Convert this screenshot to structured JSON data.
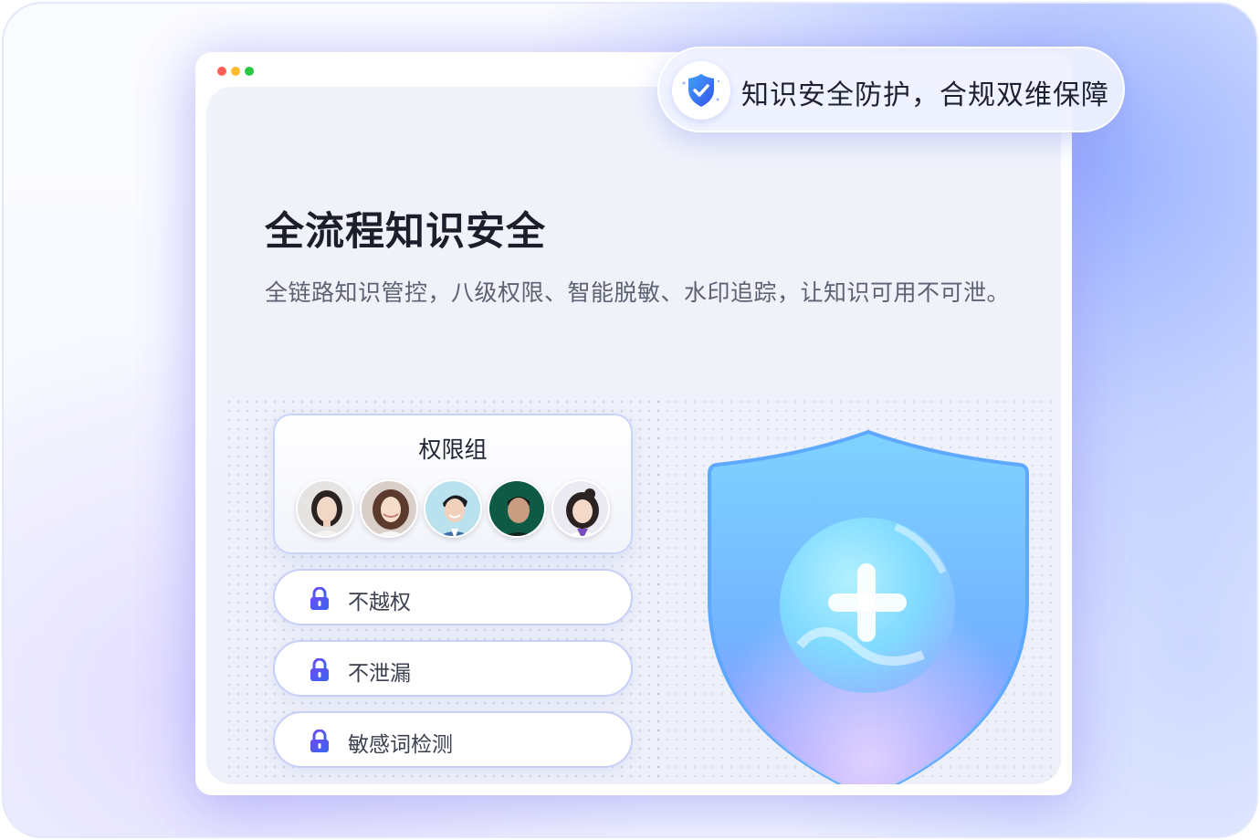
{
  "window": {
    "controls": [
      "close",
      "minimize",
      "maximize"
    ]
  },
  "badge": {
    "icon": "shield-check-icon",
    "text": "知识安全防护，合规双维保障"
  },
  "main": {
    "title": "全流程知识安全",
    "description": "全链路知识管控，八级权限、智能脱敏、水印追踪，让知识可用不可泄。"
  },
  "permission_group": {
    "title": "权限组",
    "avatars": [
      "avatar-1",
      "avatar-2",
      "avatar-3",
      "avatar-4",
      "avatar-5"
    ]
  },
  "features": [
    {
      "icon": "lock-icon",
      "label": "不越权"
    },
    {
      "icon": "lock-icon",
      "label": "不泄漏"
    },
    {
      "icon": "lock-icon",
      "label": "敏感词检测"
    }
  ],
  "illustration": {
    "icon": "shield-plus-icon"
  },
  "colors": {
    "accent": "#4f6df5",
    "lock": "#4b55e8",
    "shield_top": "#6fc6ff",
    "shield_bottom": "#9d8cff"
  }
}
